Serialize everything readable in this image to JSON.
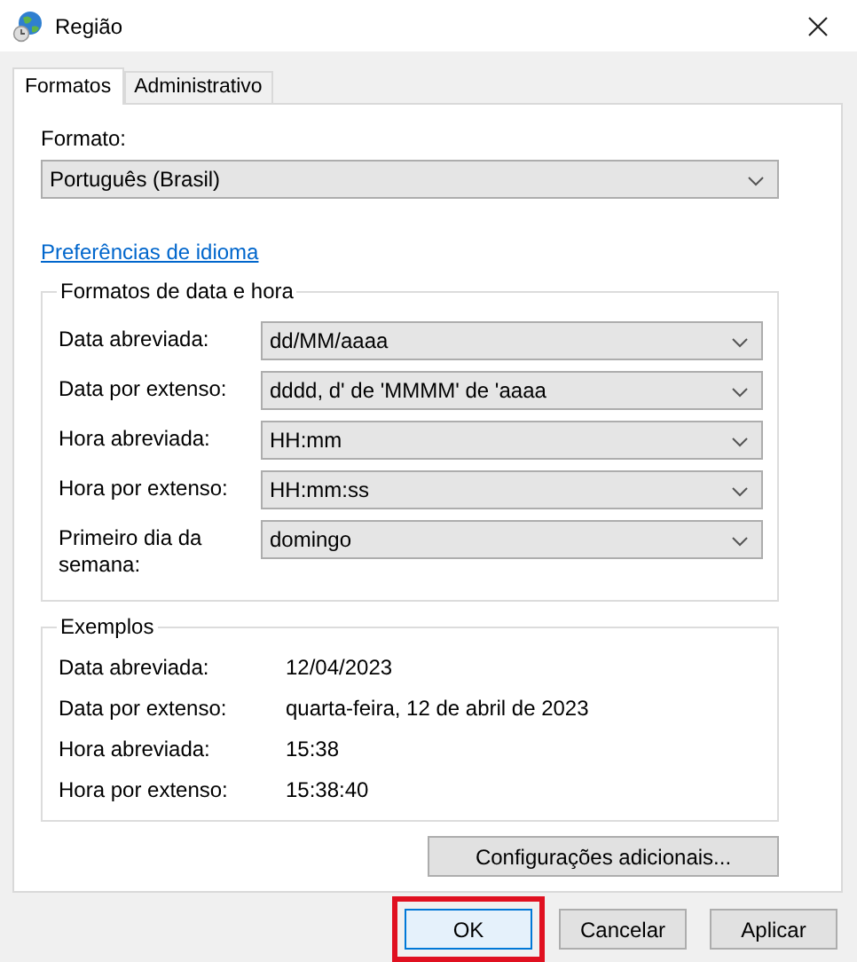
{
  "window": {
    "title": "Região"
  },
  "tabs": [
    {
      "label": "Formatos",
      "selected": true
    },
    {
      "label": "Administrativo",
      "selected": false
    }
  ],
  "format": {
    "label": "Formato:",
    "value": "Português (Brasil)"
  },
  "language_link": "Preferências de idioma",
  "date_time_formats": {
    "title": "Formatos de data e hora",
    "rows": [
      {
        "label": "Data abreviada:",
        "value": "dd/MM/aaaa"
      },
      {
        "label": "Data por extenso:",
        "value": "dddd, d' de 'MMMM' de 'aaaa"
      },
      {
        "label": "Hora abreviada:",
        "value": "HH:mm"
      },
      {
        "label": "Hora por extenso:",
        "value": "HH:mm:ss"
      },
      {
        "label": "Primeiro dia da semana:",
        "value": "domingo"
      }
    ]
  },
  "examples": {
    "title": "Exemplos",
    "rows": [
      {
        "label": "Data abreviada:",
        "value": "12/04/2023"
      },
      {
        "label": "Data por extenso:",
        "value": "quarta-feira, 12 de abril de 2023"
      },
      {
        "label": "Hora abreviada:",
        "value": "15:38"
      },
      {
        "label": "Hora por extenso:",
        "value": "15:38:40"
      }
    ]
  },
  "additional_button": "Configurações adicionais...",
  "buttons": [
    {
      "label": "OK",
      "default": true,
      "highlighted": true
    },
    {
      "label": "Cancelar",
      "default": false,
      "highlighted": false
    },
    {
      "label": "Aplicar",
      "default": false,
      "highlighted": false
    }
  ]
}
